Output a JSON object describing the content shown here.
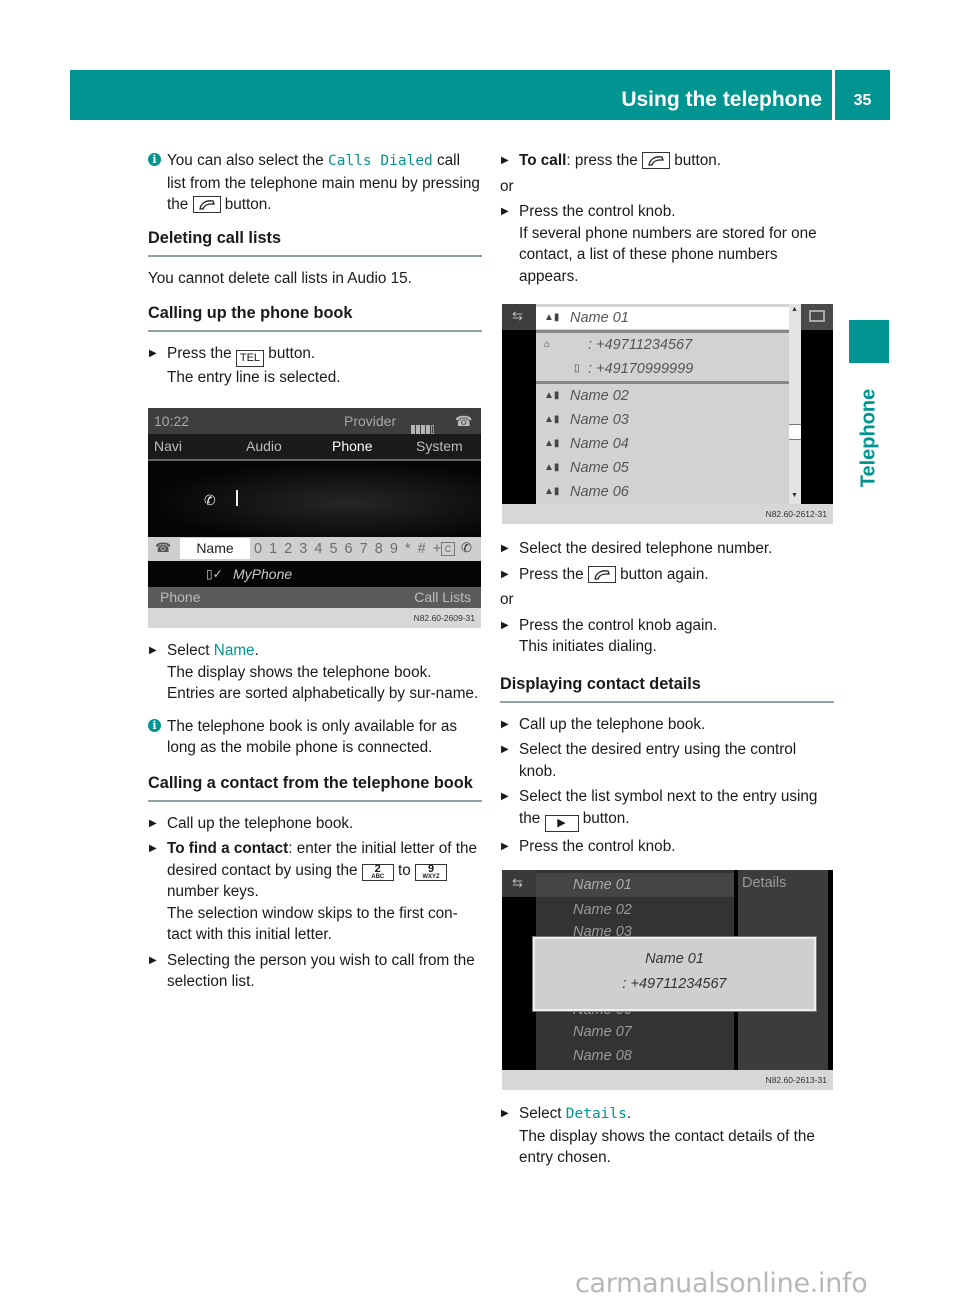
{
  "header": {
    "section_title": "Using the telephone",
    "page_number": "35",
    "accent_color": "#009590"
  },
  "side_tab": {
    "label": "Telephone"
  },
  "left_column": {
    "info1": {
      "before": "You can also select the ",
      "code": "Calls Dialed",
      "after1": " call list from the telephone main menu by pressing the ",
      "after2": " button."
    },
    "heading_deleting": "Deleting call lists",
    "deleting_text": "You cannot delete call lists in Audio 15.",
    "heading_phonebook": "Calling up the phone book",
    "step_press_tel": {
      "before": "Press the ",
      "key": "TEL",
      "after": " button.",
      "detail": "The entry line is selected."
    },
    "step_select_name": {
      "before": "Select ",
      "code": "Name",
      "after": ".",
      "detail": "The display shows the telephone book. Entries are sorted alphabetically by sur-name."
    },
    "info2": "The telephone book is only available for as long as the mobile phone is connected.",
    "heading_calling_contact": "Calling a contact from the telephone book",
    "step_call_up": "Call up the telephone book.",
    "step_find": {
      "bold": "To find a contact",
      "text1": ": enter the initial letter of the desired contact by using the ",
      "key_from": "2",
      "key_from_letters": "ABC",
      "text2": " to ",
      "key_to": "9",
      "key_to_letters": "WXYZ",
      "text3": " number keys.",
      "detail": "The selection window skips to the first con-tact with this initial letter."
    },
    "step_selecting": "Selecting the person you wish to call from the selection list."
  },
  "screen1": {
    "time": "10:22",
    "provider": "Provider",
    "menu": [
      "Navi",
      "Audio",
      "Phone",
      "System"
    ],
    "selected_menu": "Phone",
    "entry_name": "Name",
    "digits": "0 1 2 3 4 5 6 7 8 9 * # +",
    "clear_key": "C",
    "device": "MyPhone",
    "bottom_left": "Phone",
    "bottom_right": "Call Lists",
    "figure_code": "N82.60-2609-31"
  },
  "right_column": {
    "step_to_call": {
      "bold": "To call",
      "text": ": press the ",
      "after": " button."
    },
    "or1": "or",
    "step_press_knob": {
      "text": "Press the control knob.",
      "detail": "If several phone numbers are stored for one contact, a list of these phone numbers appears."
    },
    "step_select_number": "Select the desired telephone number.",
    "step_press_again": {
      "before": "Press the ",
      "after": " button again."
    },
    "or2": "or",
    "step_knob_again": {
      "text": "Press the control knob again.",
      "detail": "This initiates dialing."
    },
    "heading_details": "Displaying contact details",
    "step_call_up_book": "Call up the telephone book.",
    "step_select_entry": "Select the desired entry using the control knob.",
    "step_list_symbol": {
      "before": "Select the list symbol next to the entry using the ",
      "after": " button."
    },
    "step_press_knob2": "Press the control knob.",
    "step_select_details": {
      "before": "Select ",
      "code": "Details",
      "after": ".",
      "detail": "The display shows the contact details of the entry chosen."
    }
  },
  "screen2": {
    "selected_entry": "Name 01",
    "numbers": [
      {
        "type": "home",
        "value": ":  +49711234567"
      },
      {
        "type": "mobile",
        "value": ":  +49170999999"
      }
    ],
    "entries": [
      "Name 02",
      "Name 03",
      "Name 04",
      "Name 05",
      "Name 06"
    ],
    "figure_code": "N82.60-2612-31"
  },
  "screen3": {
    "entries": [
      "Name 01",
      "Name 02",
      "Name 03",
      "Name 06",
      "Name 07",
      "Name 08"
    ],
    "details_label": "Details",
    "popup_name": "Name 01",
    "popup_number": ":  +49711234567",
    "figure_code": "N82.60-2613-31"
  },
  "watermark": "carmanualsonline.info"
}
